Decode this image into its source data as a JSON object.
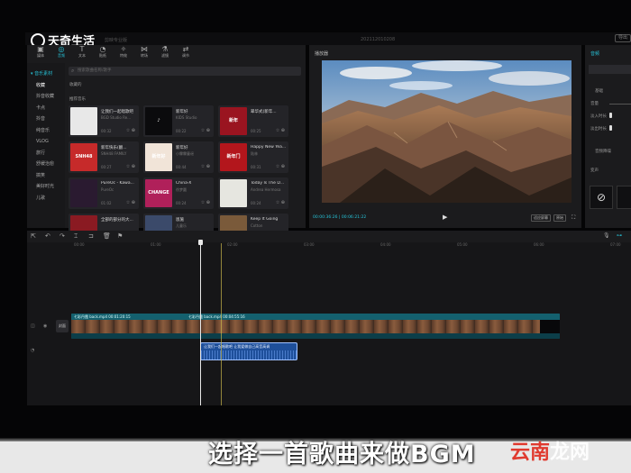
{
  "logo": {
    "text": "天奇生活"
  },
  "topbar": {
    "left_text": "剪映专业版",
    "center_text": "202112010208",
    "right_btn": "导出"
  },
  "toolbar": {
    "items": [
      {
        "icon": "▣",
        "label": "媒体"
      },
      {
        "icon": "◎",
        "label": "音频"
      },
      {
        "icon": "T",
        "label": "文本"
      },
      {
        "icon": "◔",
        "label": "贴纸"
      },
      {
        "icon": "✧",
        "label": "特效"
      },
      {
        "icon": "⋈",
        "label": "转场"
      },
      {
        "icon": "⚗",
        "label": "滤镜"
      },
      {
        "icon": "⇄",
        "label": "调节"
      }
    ]
  },
  "sidebar": {
    "header": "▾ 音乐素材",
    "items": [
      "收藏",
      "抖音收藏",
      "卡点",
      "抖音",
      "纯音乐",
      "VLOG",
      "旅行",
      "舒缓治愈",
      "搞笑",
      "美好时光",
      "儿歌"
    ]
  },
  "search": {
    "placeholder": "搜索歌曲名称/歌手"
  },
  "section": {
    "recent": "收藏的",
    "library": "推荐音乐"
  },
  "music": [
    {
      "title": "让我们一起唱歌吧",
      "artist": "BGD Studio Re...",
      "duration": "00:32",
      "cover": "#e8e8e8",
      "cover_text": ""
    },
    {
      "title": "新年好",
      "artist": "KIDS Studio",
      "duration": "00:22",
      "cover": "#0b0b0d",
      "cover_text": "♪"
    },
    {
      "title": "翠华式(新年...",
      "artist": "",
      "duration": "00:25",
      "cover": "#9a1420",
      "cover_text": "新年"
    },
    {
      "title": "新年快乐(翻...",
      "artist": "SNH48 FAMILY",
      "duration": "00:27",
      "cover": "#c62a2a",
      "cover_text": "SNH48"
    },
    {
      "title": "新年好",
      "artist": "小霖霖童谣",
      "duration": "00:44",
      "cover": "#f1e4d8",
      "cover_text": "新年好"
    },
    {
      "title": "Happy New Yea...",
      "artist": "陆林",
      "duration": "00:31",
      "cover": "#b3161c",
      "cover_text": "新年门"
    },
    {
      "title": "PureOc - Kawa...",
      "artist": "PureOc",
      "duration": "01:02",
      "cover": "#2a1a30",
      "cover_text": ""
    },
    {
      "title": "China-X",
      "artist": "徐梦圆",
      "duration": "00:24",
      "cover": "#b0205a",
      "cover_text": "CHANGE"
    },
    {
      "title": "Today Is The D...",
      "artist": "Andrea Hermosa",
      "duration": "00:24",
      "cover": "#e6e6e0",
      "cover_text": ""
    },
    {
      "title": "全部的部分的大...",
      "artist": "",
      "duration": "00:41",
      "cover": "#8a1a22",
      "cover_text": ""
    },
    {
      "title": "恩施",
      "artist": "儿童乐",
      "duration": "00:22",
      "cover": "#3b4a6a",
      "cover_text": ""
    },
    {
      "title": "Keep It Going",
      "artist": "Cotton",
      "duration": "00:21",
      "cover": "#7a5a3a",
      "cover_text": ""
    }
  ],
  "player": {
    "title": "播放器",
    "time": "00:00:36:26 | 00:06:21:22",
    "ratio": "适应屏幕",
    "orig": "原始"
  },
  "right_panel": {
    "tab": "音频",
    "bar": "基础",
    "labels": [
      "基础",
      "音量",
      "淡入时长",
      "淡出时长",
      "音频降噪",
      "变声"
    ]
  },
  "timeline": {
    "ticks": [
      "00:00",
      "01:00",
      "02:00",
      "03:00",
      "04:00",
      "05:00",
      "06:00",
      "07:00"
    ],
    "cover_label": "封面",
    "video_clip_1": "七彩丹霞 back.mp4  00:01:20:15",
    "video_clip_2": "七彩丹霞 back.mp4  00:04:55:16",
    "audio_clip": "让我们一起唱歌吧 让我爱做自己高音高调",
    "tools": [
      "⇱",
      "↶",
      "↷",
      "⌶",
      "⊐",
      "🗑",
      "⚑"
    ]
  },
  "caption": {
    "main": "选择一首歌曲来做BGM"
  },
  "watermark": {
    "red": "云南",
    "white": "龙网"
  }
}
